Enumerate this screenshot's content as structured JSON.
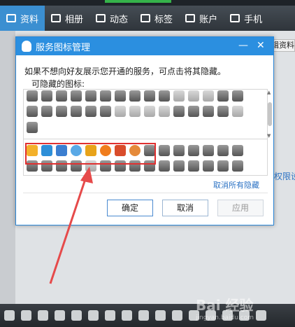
{
  "app": {
    "tabs": [
      {
        "label": "资料",
        "icon": "profile-card-icon"
      },
      {
        "label": "相册",
        "icon": "album-icon"
      },
      {
        "label": "动态",
        "icon": "feed-icon"
      },
      {
        "label": "标签",
        "icon": "tag-icon"
      },
      {
        "label": "账户",
        "icon": "account-icon"
      },
      {
        "label": "手机",
        "icon": "phone-icon"
      }
    ],
    "edit_profile": "编辑资料",
    "permission_link": "权限设置"
  },
  "dialog": {
    "title": "服务图标管理",
    "minimize": "—",
    "close": "✕",
    "description": "如果不想向好友展示您开通的服务，可点击将其隐藏。",
    "hideable_label": "可隐藏的图标:",
    "cancel_all_hidden": "取消所有隐藏",
    "buttons": {
      "ok": "确定",
      "cancel": "取消",
      "apply": "应用"
    }
  },
  "watermark": {
    "text": "Bai 经验",
    "sub": "jingyan.baidu.com"
  },
  "colors": {
    "accent": "#2b8fe0",
    "highlight_box": "#e03030",
    "active_tab": "#3b8fd1"
  }
}
